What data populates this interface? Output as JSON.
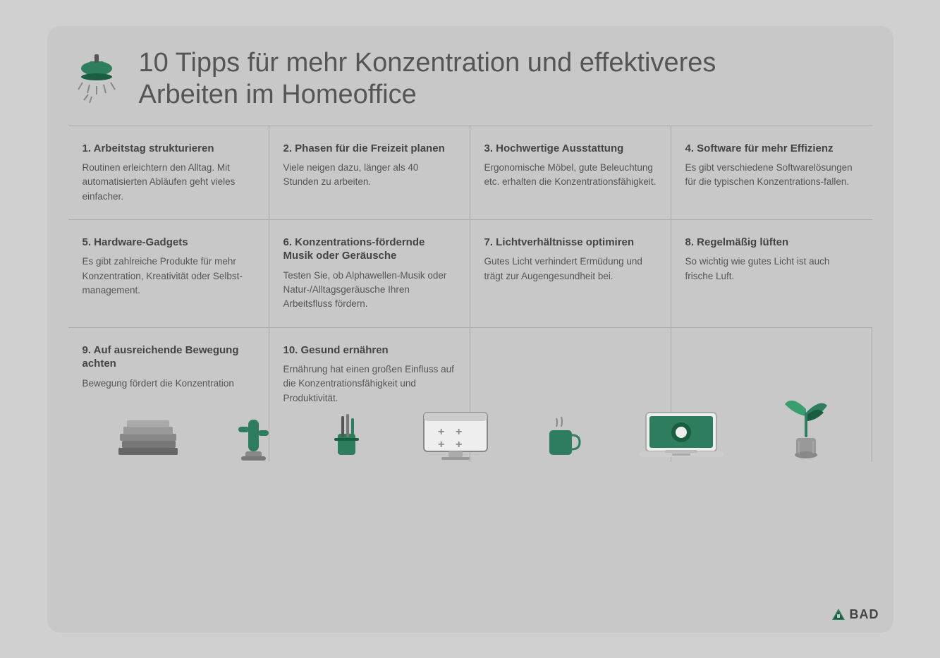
{
  "header": {
    "title_line1": "10 Tipps für mehr Konzentration und effektiveres",
    "title_line2": "Arbeiten im Homeoffice"
  },
  "tips": [
    {
      "id": "tip-1",
      "title": "1. Arbeitstag strukturieren",
      "text": "Routinen erleichtern den Alltag. Mit automatisierten Abläufen geht vieles einfacher."
    },
    {
      "id": "tip-2",
      "title": "2. Phasen für die Freizeit planen",
      "text": "Viele neigen dazu, länger als 40 Stunden zu arbeiten."
    },
    {
      "id": "tip-3",
      "title": "3. Hochwertige Ausstattung",
      "text": "Ergonomische Möbel, gute Beleuchtung etc. erhalten die Konzentrationsfähigkeit."
    },
    {
      "id": "tip-4",
      "title": "4. Software für mehr Effizienz",
      "text": "Es gibt verschiedene Softwarelösungen für die typischen Konzentrations-fallen."
    },
    {
      "id": "tip-5",
      "title": "5. Hardware-Gadgets",
      "text": "Es gibt zahlreiche Produkte für mehr Konzentration, Kreativität oder Selbst-management."
    },
    {
      "id": "tip-6",
      "title": "6. Konzentrations-fördernde Musik oder Geräusche",
      "text": "Testen Sie, ob Alphawellen-Musik oder Natur-/Alltagsgeräusche Ihren Arbeitsfluss fördern."
    },
    {
      "id": "tip-7",
      "title": "7. Lichtverhältnisse optimiren",
      "text": "Gutes Licht verhindert Ermüdung und trägt zur Augengesundheit bei."
    },
    {
      "id": "tip-8",
      "title": "8. Regelmäßig lüften",
      "text": "So wichtig wie gutes Licht ist auch frische Luft."
    },
    {
      "id": "tip-9",
      "title": "9. Auf ausreichende Bewegung achten",
      "text": "Bewegung fördert die Konzentration"
    },
    {
      "id": "tip-10",
      "title": "10. Gesund ernähren",
      "text": "Ernährung hat einen großen Einfluss auf die Konzentrationsfähigkeit und Produktivität."
    }
  ],
  "brand": {
    "name": "BAD"
  },
  "colors": {
    "green": "#2e7d5e",
    "dark_green": "#1a5e40",
    "light_green": "#3a9e6e",
    "bg": "#c8c8c8",
    "text_dark": "#444444",
    "text_medium": "#555555"
  }
}
